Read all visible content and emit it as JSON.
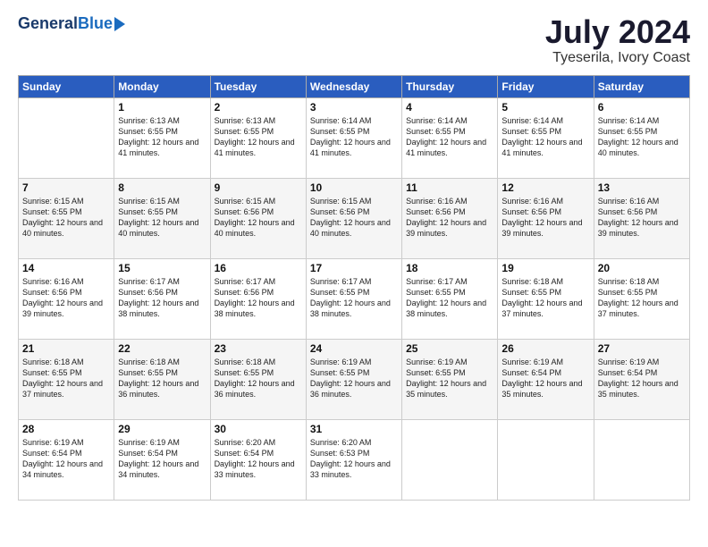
{
  "header": {
    "logo_general": "General",
    "logo_blue": "Blue",
    "title": "July 2024",
    "subtitle": "Tyeserila, Ivory Coast"
  },
  "weekdays": [
    "Sunday",
    "Monday",
    "Tuesday",
    "Wednesday",
    "Thursday",
    "Friday",
    "Saturday"
  ],
  "weeks": [
    [
      {
        "day": "",
        "sunrise": "",
        "sunset": "",
        "daylight": ""
      },
      {
        "day": "1",
        "sunrise": "6:13 AM",
        "sunset": "6:55 PM",
        "daylight": "12 hours and 41 minutes."
      },
      {
        "day": "2",
        "sunrise": "6:13 AM",
        "sunset": "6:55 PM",
        "daylight": "12 hours and 41 minutes."
      },
      {
        "day": "3",
        "sunrise": "6:14 AM",
        "sunset": "6:55 PM",
        "daylight": "12 hours and 41 minutes."
      },
      {
        "day": "4",
        "sunrise": "6:14 AM",
        "sunset": "6:55 PM",
        "daylight": "12 hours and 41 minutes."
      },
      {
        "day": "5",
        "sunrise": "6:14 AM",
        "sunset": "6:55 PM",
        "daylight": "12 hours and 41 minutes."
      },
      {
        "day": "6",
        "sunrise": "6:14 AM",
        "sunset": "6:55 PM",
        "daylight": "12 hours and 40 minutes."
      }
    ],
    [
      {
        "day": "7",
        "sunrise": "6:15 AM",
        "sunset": "6:55 PM",
        "daylight": "12 hours and 40 minutes."
      },
      {
        "day": "8",
        "sunrise": "6:15 AM",
        "sunset": "6:55 PM",
        "daylight": "12 hours and 40 minutes."
      },
      {
        "day": "9",
        "sunrise": "6:15 AM",
        "sunset": "6:56 PM",
        "daylight": "12 hours and 40 minutes."
      },
      {
        "day": "10",
        "sunrise": "6:15 AM",
        "sunset": "6:56 PM",
        "daylight": "12 hours and 40 minutes."
      },
      {
        "day": "11",
        "sunrise": "6:16 AM",
        "sunset": "6:56 PM",
        "daylight": "12 hours and 39 minutes."
      },
      {
        "day": "12",
        "sunrise": "6:16 AM",
        "sunset": "6:56 PM",
        "daylight": "12 hours and 39 minutes."
      },
      {
        "day": "13",
        "sunrise": "6:16 AM",
        "sunset": "6:56 PM",
        "daylight": "12 hours and 39 minutes."
      }
    ],
    [
      {
        "day": "14",
        "sunrise": "6:16 AM",
        "sunset": "6:56 PM",
        "daylight": "12 hours and 39 minutes."
      },
      {
        "day": "15",
        "sunrise": "6:17 AM",
        "sunset": "6:56 PM",
        "daylight": "12 hours and 38 minutes."
      },
      {
        "day": "16",
        "sunrise": "6:17 AM",
        "sunset": "6:56 PM",
        "daylight": "12 hours and 38 minutes."
      },
      {
        "day": "17",
        "sunrise": "6:17 AM",
        "sunset": "6:55 PM",
        "daylight": "12 hours and 38 minutes."
      },
      {
        "day": "18",
        "sunrise": "6:17 AM",
        "sunset": "6:55 PM",
        "daylight": "12 hours and 38 minutes."
      },
      {
        "day": "19",
        "sunrise": "6:18 AM",
        "sunset": "6:55 PM",
        "daylight": "12 hours and 37 minutes."
      },
      {
        "day": "20",
        "sunrise": "6:18 AM",
        "sunset": "6:55 PM",
        "daylight": "12 hours and 37 minutes."
      }
    ],
    [
      {
        "day": "21",
        "sunrise": "6:18 AM",
        "sunset": "6:55 PM",
        "daylight": "12 hours and 37 minutes."
      },
      {
        "day": "22",
        "sunrise": "6:18 AM",
        "sunset": "6:55 PM",
        "daylight": "12 hours and 36 minutes."
      },
      {
        "day": "23",
        "sunrise": "6:18 AM",
        "sunset": "6:55 PM",
        "daylight": "12 hours and 36 minutes."
      },
      {
        "day": "24",
        "sunrise": "6:19 AM",
        "sunset": "6:55 PM",
        "daylight": "12 hours and 36 minutes."
      },
      {
        "day": "25",
        "sunrise": "6:19 AM",
        "sunset": "6:55 PM",
        "daylight": "12 hours and 35 minutes."
      },
      {
        "day": "26",
        "sunrise": "6:19 AM",
        "sunset": "6:54 PM",
        "daylight": "12 hours and 35 minutes."
      },
      {
        "day": "27",
        "sunrise": "6:19 AM",
        "sunset": "6:54 PM",
        "daylight": "12 hours and 35 minutes."
      }
    ],
    [
      {
        "day": "28",
        "sunrise": "6:19 AM",
        "sunset": "6:54 PM",
        "daylight": "12 hours and 34 minutes."
      },
      {
        "day": "29",
        "sunrise": "6:19 AM",
        "sunset": "6:54 PM",
        "daylight": "12 hours and 34 minutes."
      },
      {
        "day": "30",
        "sunrise": "6:20 AM",
        "sunset": "6:54 PM",
        "daylight": "12 hours and 33 minutes."
      },
      {
        "day": "31",
        "sunrise": "6:20 AM",
        "sunset": "6:53 PM",
        "daylight": "12 hours and 33 minutes."
      },
      {
        "day": "",
        "sunrise": "",
        "sunset": "",
        "daylight": ""
      },
      {
        "day": "",
        "sunrise": "",
        "sunset": "",
        "daylight": ""
      },
      {
        "day": "",
        "sunrise": "",
        "sunset": "",
        "daylight": ""
      }
    ]
  ]
}
